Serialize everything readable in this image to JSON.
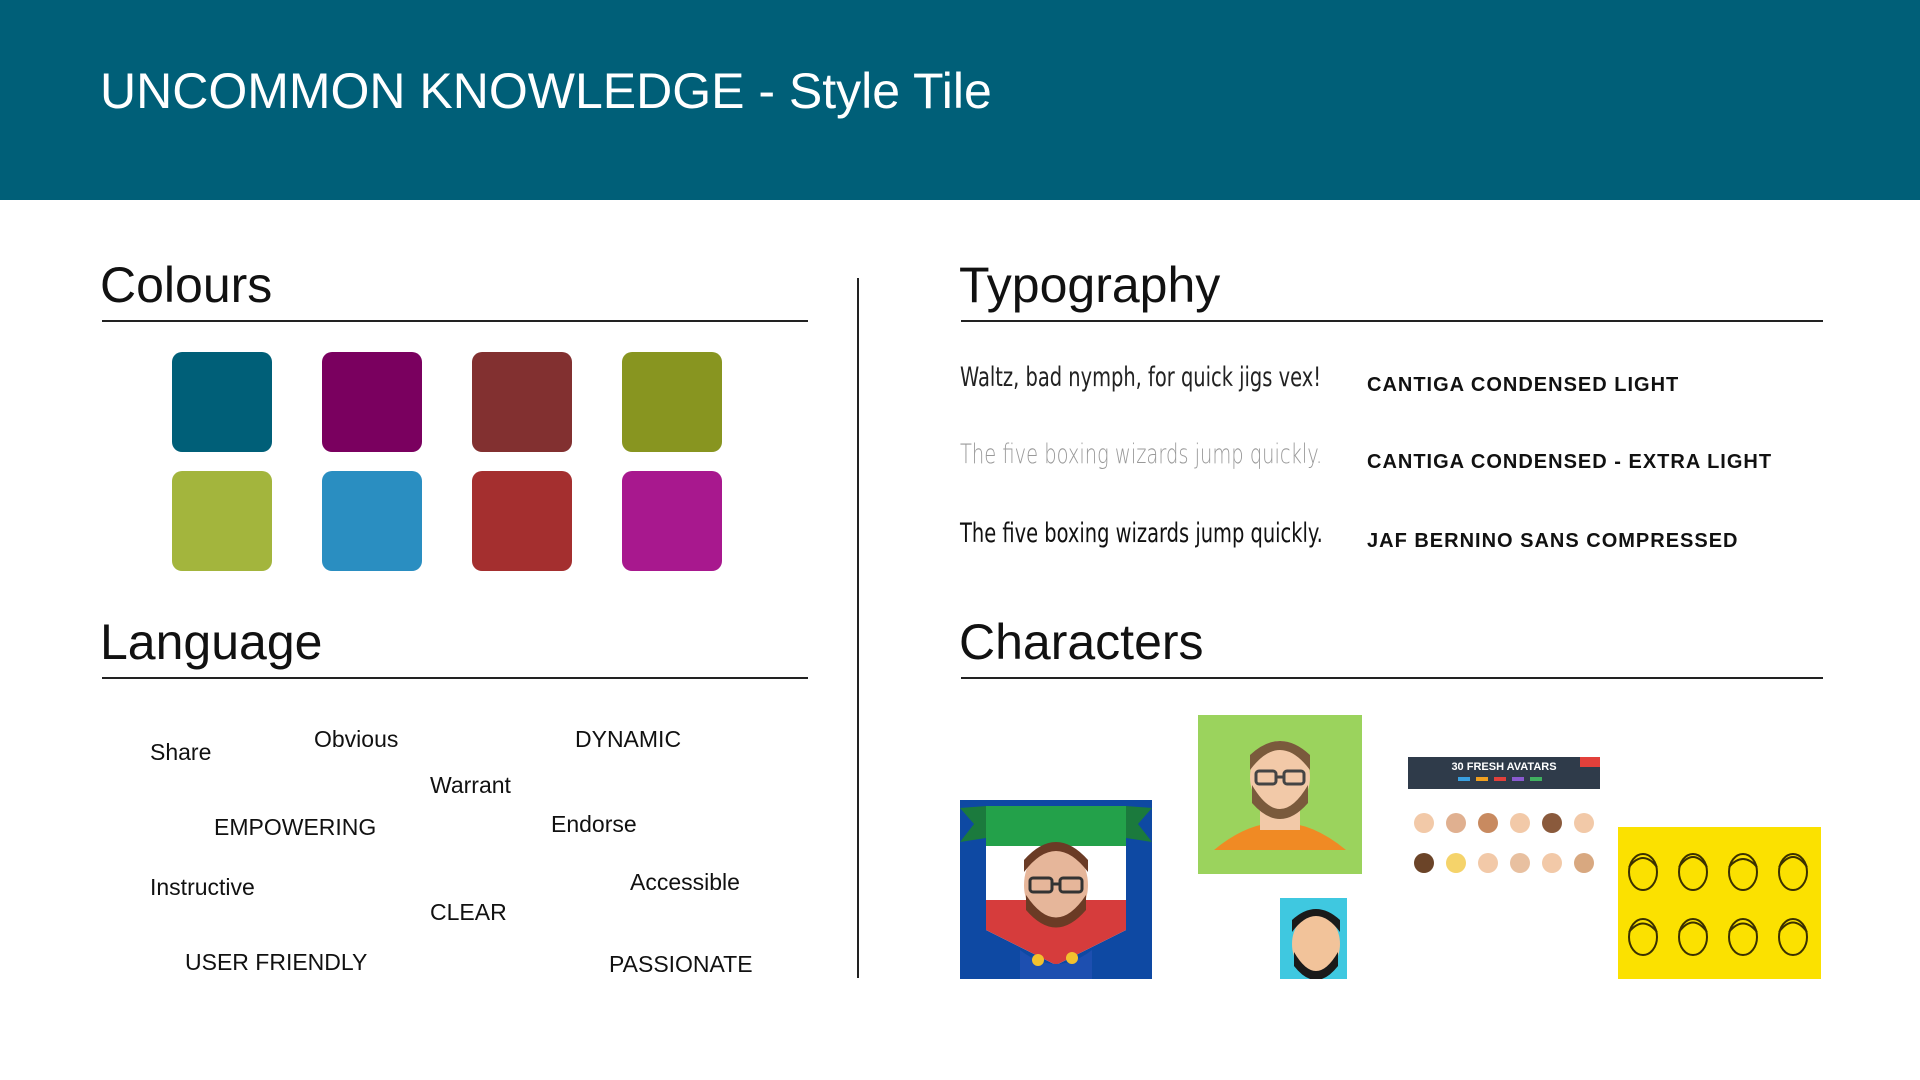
{
  "header": {
    "title": "UNCOMMON KNOWLEDGE - Style Tile",
    "background": "#005f78"
  },
  "colours": {
    "title": "Colours",
    "swatches": [
      {
        "name": "teal",
        "hex": "#005f78"
      },
      {
        "name": "plum",
        "hex": "#7a005f"
      },
      {
        "name": "brick",
        "hex": "#823030"
      },
      {
        "name": "olive",
        "hex": "#889520"
      },
      {
        "name": "lime",
        "hex": "#a3b53d"
      },
      {
        "name": "sky-blue",
        "hex": "#2a8ec1"
      },
      {
        "name": "red",
        "hex": "#a42f2f"
      },
      {
        "name": "magenta",
        "hex": "#a8188e"
      }
    ]
  },
  "language": {
    "title": "Language",
    "words": [
      "Share",
      "Obvious",
      "DYNAMIC",
      "Warrant",
      "EMPOWERING",
      "Endorse",
      "Instructive",
      "Accessible",
      "CLEAR",
      "USER FRIENDLY",
      "PASSIONATE"
    ]
  },
  "typography": {
    "title": "Typography",
    "rows": [
      {
        "sample": "Waltz, bad nymph, for quick jigs vex!",
        "font_name": "CANTIGA CONDENSED LIGHT",
        "sample_color": "#222222"
      },
      {
        "sample": "The five boxing wizards jump quickly.",
        "font_name": "CANTIGA CONDENSED -  EXTRA LIGHT",
        "sample_color": "#999999"
      },
      {
        "sample": "The five boxing wizards jump quickly.",
        "font_name": "JAF BERNINO SANS COMPRESSED",
        "sample_color": "#111111"
      }
    ]
  },
  "characters": {
    "title": "Characters",
    "avatars_banner": "30 FRESH AVATARS"
  }
}
